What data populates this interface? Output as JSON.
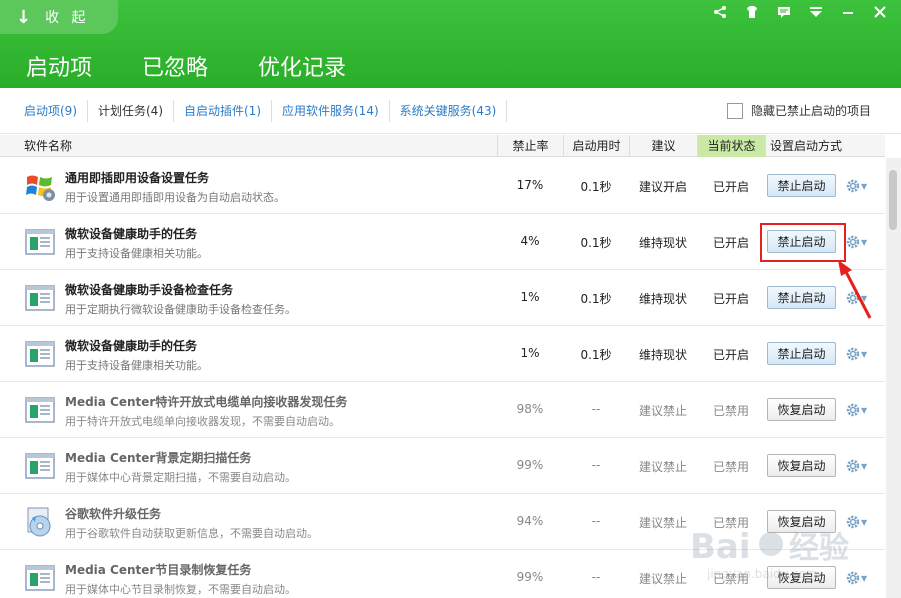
{
  "header": {
    "collapse_label": "收 起",
    "tabs": [
      {
        "label": "启动项",
        "active": true
      },
      {
        "label": "已忽略",
        "active": false
      },
      {
        "label": "优化记录",
        "active": false
      }
    ],
    "window_icons": [
      "share-icon",
      "skin-icon",
      "message-icon",
      "menu-icon",
      "minimize-icon",
      "close-icon"
    ]
  },
  "filters": {
    "items": [
      {
        "label": "启动项(9)"
      },
      {
        "label": "计划任务(4)"
      },
      {
        "label": "自启动插件(1)"
      },
      {
        "label": "应用软件服务(14)"
      },
      {
        "label": "系统关键服务(43)"
      }
    ],
    "hide_disabled_label": "隐藏已禁止启动的项目"
  },
  "columns": {
    "name": "软件名称",
    "rate": "禁止率",
    "time": "启动用时",
    "suggestion": "建议",
    "state": "当前状态",
    "setting": "设置启动方式"
  },
  "rows": [
    {
      "title": "通用即插即用设备设置任务",
      "desc": "用于设置通用即插即用设备为自动启动状态。",
      "rate": "17%",
      "time": "0.1秒",
      "suggestion": "建议开启",
      "state": "已开启",
      "action": "禁止启动",
      "icon": "windows-logo-icon",
      "disabled": false
    },
    {
      "title": "微软设备健康助手的任务",
      "desc": "用于支持设备健康相关功能。",
      "rate": "4%",
      "time": "0.1秒",
      "suggestion": "维持现状",
      "state": "已开启",
      "action": "禁止启动",
      "icon": "program-window-icon",
      "disabled": false
    },
    {
      "title": "微软设备健康助手设备检查任务",
      "desc": "用于定期执行微软设备健康助手设备检查任务。",
      "rate": "1%",
      "time": "0.1秒",
      "suggestion": "维持现状",
      "state": "已开启",
      "action": "禁止启动",
      "icon": "program-window-icon",
      "disabled": false
    },
    {
      "title": "微软设备健康助手的任务",
      "desc": "用于支持设备健康相关功能。",
      "rate": "1%",
      "time": "0.1秒",
      "suggestion": "维持现状",
      "state": "已开启",
      "action": "禁止启动",
      "icon": "program-window-icon",
      "disabled": false
    },
    {
      "title": "Media Center特许开放式电缆单向接收器发现任务",
      "desc": "用于特许开放式电缆单向接收器发现，不需要自动启动。",
      "rate": "98%",
      "time": "--",
      "suggestion": "建议禁止",
      "state": "已禁用",
      "action": "恢复启动",
      "icon": "program-window-icon",
      "disabled": true
    },
    {
      "title": "Media Center背景定期扫描任务",
      "desc": "用于媒体中心背景定期扫描，不需要自动启动。",
      "rate": "99%",
      "time": "--",
      "suggestion": "建议禁止",
      "state": "已禁用",
      "action": "恢复启动",
      "icon": "program-window-icon",
      "disabled": true
    },
    {
      "title": "谷歌软件升级任务",
      "desc": "用于谷歌软件自动获取更新信息，不需要自动启动。",
      "rate": "94%",
      "time": "--",
      "suggestion": "建议禁止",
      "state": "已禁用",
      "action": "恢复启动",
      "icon": "install-cd-icon",
      "disabled": true
    },
    {
      "title": "Media Center节目录制恢复任务",
      "desc": "用于媒体中心节目录制恢复，不需要自动启动。",
      "rate": "99%",
      "time": "--",
      "suggestion": "建议禁止",
      "state": "已禁用",
      "action": "恢复启动",
      "icon": "program-window-icon",
      "disabled": true
    }
  ],
  "colors": {
    "header_green": "#2aae2a",
    "state_column_bg": "#c9e9a5",
    "highlight_red": "#e61f1f",
    "link_blue": "#2c7bc7"
  }
}
